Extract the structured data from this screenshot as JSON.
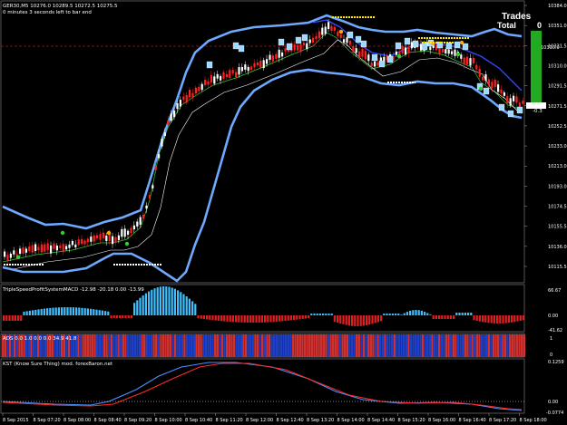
{
  "header": {
    "symbol_line": "GER30,M5  10276.0 10289.5 10272.5 10275.5",
    "timer_line": "0 minutes 3 seconds left to bar end"
  },
  "trades_panel": {
    "title": "Trades",
    "total_label": "Total",
    "count": "0",
    "profit": "-0.3"
  },
  "price_axis": {
    "labels": [
      "10384.0",
      "10351.0",
      "10331.5",
      "10310.0",
      "10291.5",
      "10271.5",
      "10252.5",
      "10233.0",
      "10213.0",
      "10193.0",
      "10174.5",
      "10155.5",
      "10136.0",
      "10115.5"
    ],
    "current_price": "10275.5",
    "marker_price": "10310.0"
  },
  "indicators": {
    "macd": {
      "label": "TripleSpeedProfitSystemMACD -12.98 -20.18 0.00 -13.99",
      "axis": [
        "66.67",
        "0.00",
        "-41.62"
      ]
    },
    "ads": {
      "label": "ADS 0.0 1.0 0.0 0.0 34.9 41.8",
      "axis": [
        "1",
        "0"
      ]
    },
    "kst": {
      "label": "KST (Know Sure Thing) mod. forexBaron.net",
      "axis": [
        "0.1259",
        "0.00",
        "-0.0774"
      ]
    }
  },
  "time_axis": [
    "8 Sep 2015",
    "8 Sep 07:20",
    "8 Sep 08:00",
    "8 Sep 08:40",
    "8 Sep 09:20",
    "8 Sep 10:00",
    "8 Sep 10:40",
    "8 Sep 11:20",
    "8 Sep 12:00",
    "8 Sep 12:40",
    "8 Sep 13:20",
    "8 Sep 14:00",
    "8 Sep 14:40",
    "8 Sep 15:20",
    "8 Sep 16:00",
    "8 Sep 16:40",
    "8 Sep 17:20",
    "8 Sep 18:00"
  ],
  "colors": {
    "background": "#000000",
    "bull_candle": "#ffffff",
    "bear_candle": "#ff2020",
    "band": "#6fa8ff",
    "ma_green": "#33cc33",
    "ma_white": "#ffffff",
    "macd_pos": "#3fbfff",
    "macd_neg": "#e02020",
    "ads_blue": "#1e40c8",
    "ads_red": "#d03030",
    "kst_blue": "#4a90ff",
    "kst_red": "#ff2a2a",
    "profit_bar": "#22aa22"
  }
}
